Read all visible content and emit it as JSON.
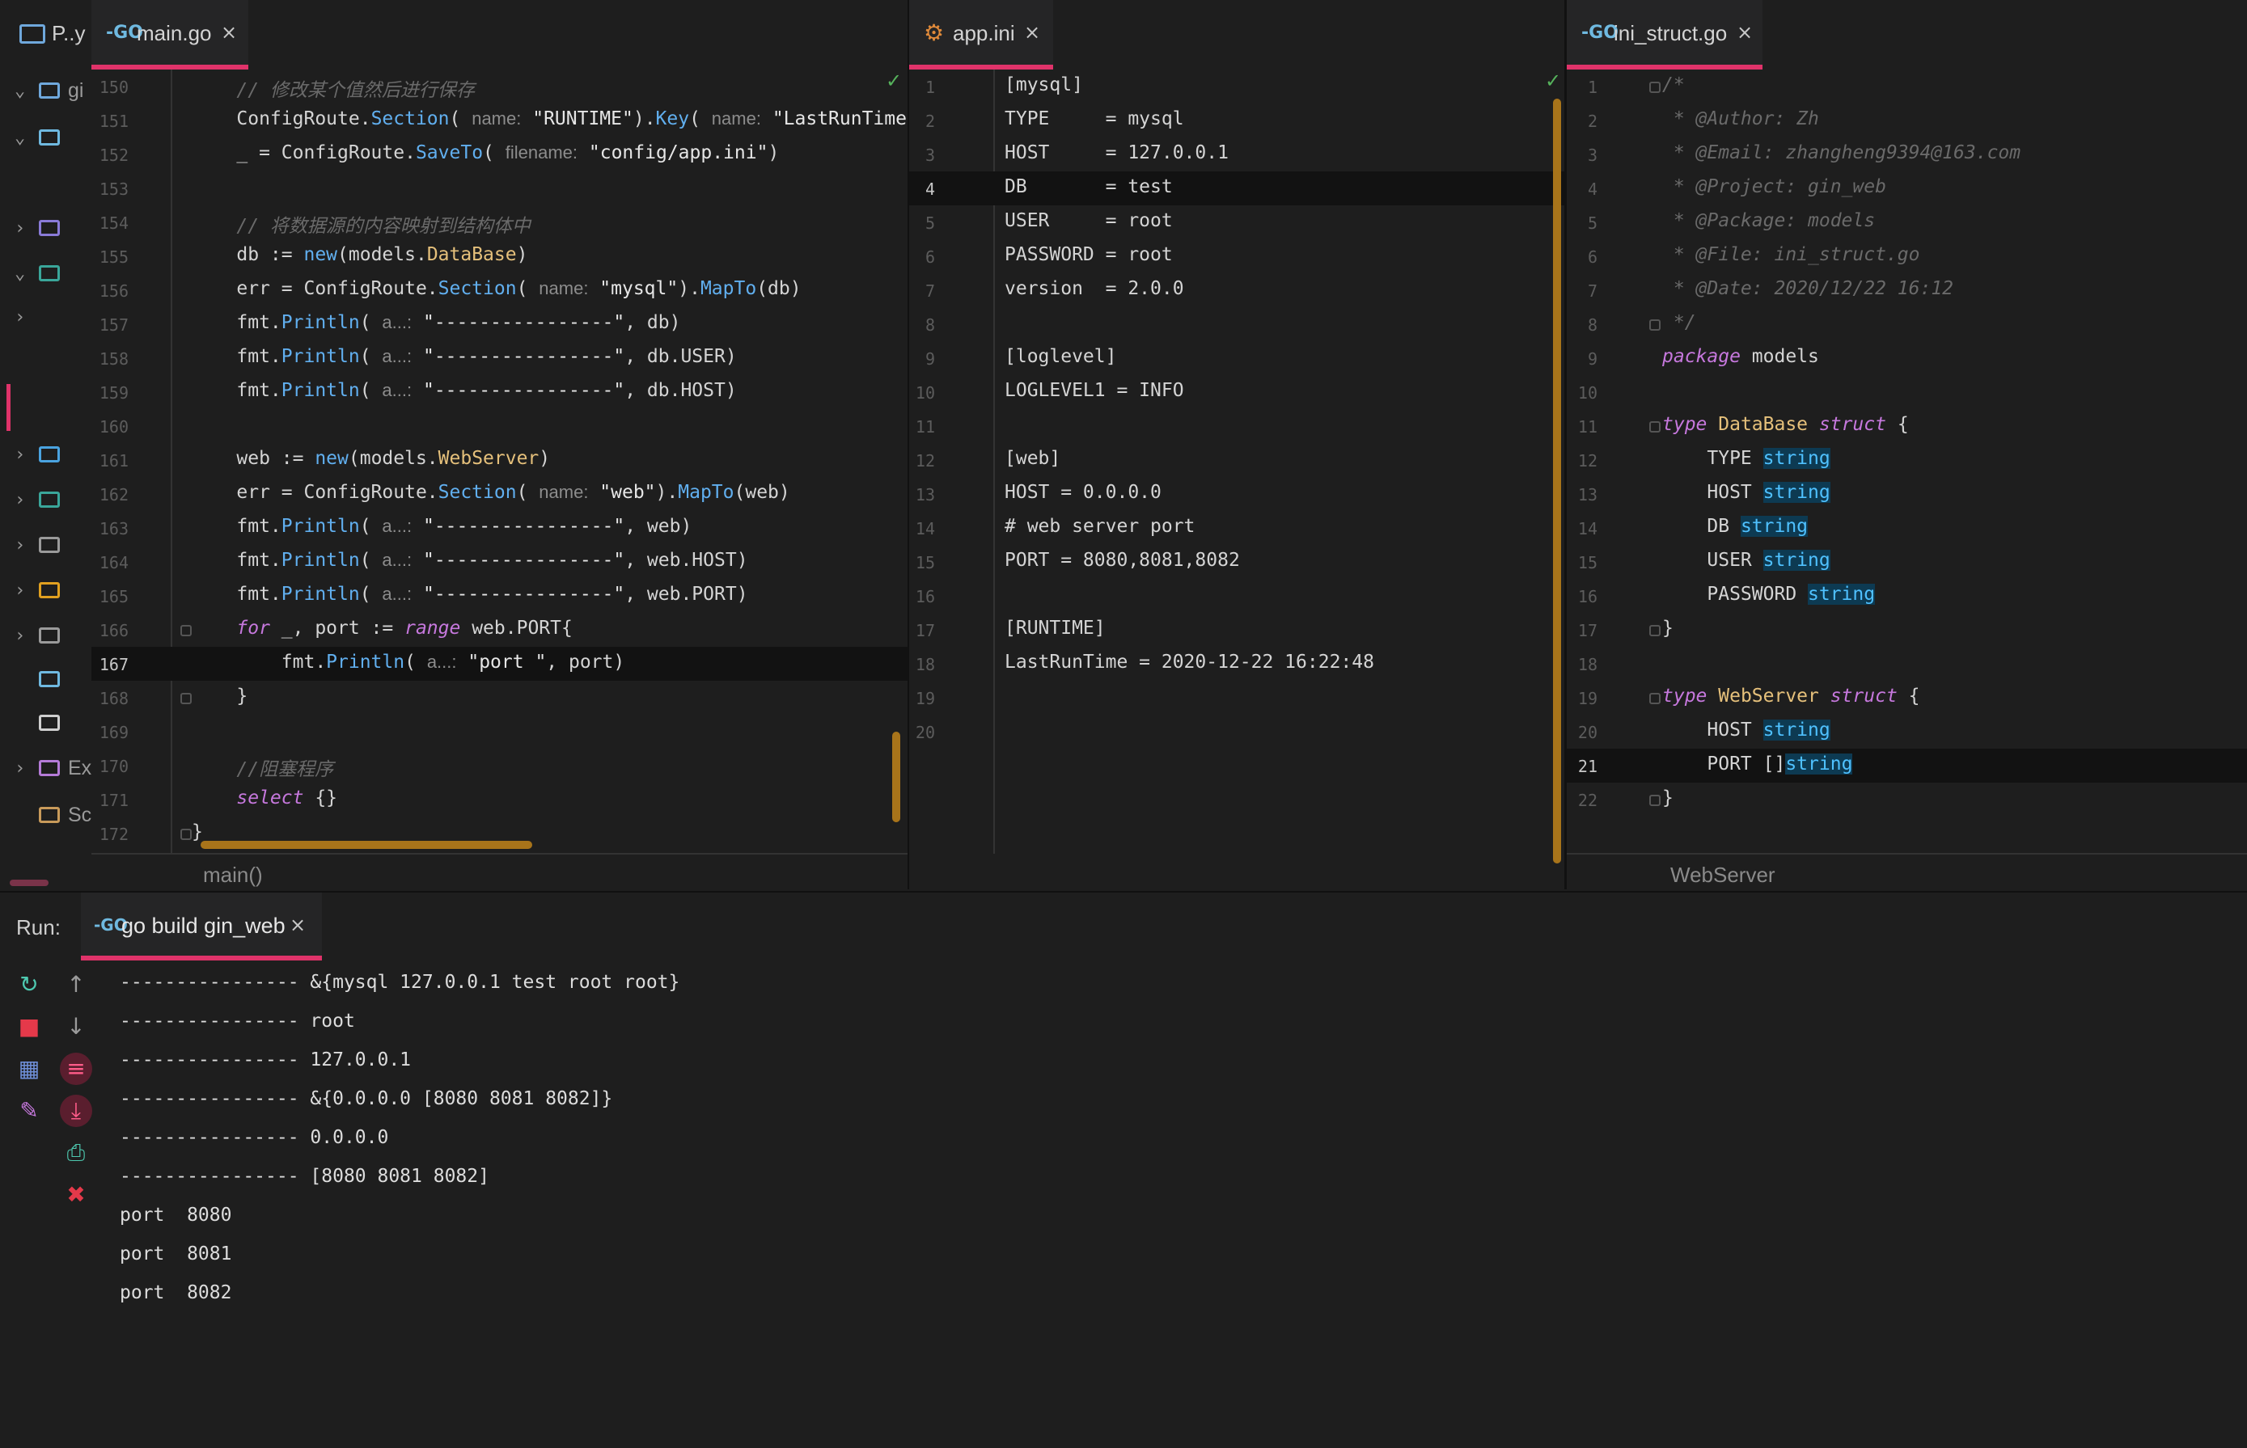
{
  "sidebar": {
    "project_label": "P..y",
    "items": [
      {
        "chev": "⌄",
        "text": "gi",
        "color": "#6fa8dc"
      },
      {
        "chev": "⌄",
        "text": "",
        "color": "#6fb9e0"
      },
      {
        "chev": "›",
        "text": "",
        "color": "#8a7bd8"
      },
      {
        "chev": "⌄",
        "text": "",
        "color": "#3aa69a"
      },
      {
        "chev": "›",
        "text": "",
        "color": ""
      },
      {
        "chev": "›",
        "text": "",
        "color": "#4aa3e0"
      },
      {
        "chev": "›",
        "text": "",
        "color": "#3aa69a"
      },
      {
        "chev": "›",
        "text": "",
        "color": "#9a9a9a"
      },
      {
        "chev": "›",
        "text": "",
        "color": "#e0a020"
      },
      {
        "chev": "›",
        "text": "",
        "color": "#9a9a9a"
      },
      {
        "chev": "",
        "text": "",
        "color": "#6fb9e0"
      },
      {
        "chev": "",
        "text": "",
        "color": "#cfcfcf"
      },
      {
        "chev": "›",
        "text": "Ex",
        "color": "#b57bd8"
      },
      {
        "chev": "",
        "text": "Sc",
        "color": "#c89a5a"
      }
    ]
  },
  "main_pane": {
    "tab_icon": "-GO",
    "tab_label": "main.go",
    "breadcrumb": "main()",
    "lines": [
      {
        "n": "150",
        "html": "    <span class=\"cm\">// 修改某个值然后进行保存</span>"
      },
      {
        "n": "151",
        "html": "    ConfigRoute.<span class=\"fn\">Section</span>( <span class=\"hint\">name:</span> <span class=\"str\">\"RUNTIME\"</span>).<span class=\"fn\">Key</span>( <span class=\"hint\">name:</span> <span class=\"str\">\"LastRunTime\"</span>)"
      },
      {
        "n": "152",
        "html": "    _ = ConfigRoute.<span class=\"fn\">SaveTo</span>( <span class=\"hint\">filename:</span> <span class=\"str\">\"config/app.ini\"</span>)"
      },
      {
        "n": "153",
        "html": ""
      },
      {
        "n": "154",
        "html": "    <span class=\"cm\">// 将数据源的内容映射到结构体中</span>"
      },
      {
        "n": "155",
        "html": "    db := <span class=\"fn\">new</span>(models.<span class=\"typ\">DataBase</span>)"
      },
      {
        "n": "156",
        "html": "    err = ConfigRoute.<span class=\"fn\">Section</span>( <span class=\"hint\">name:</span> <span class=\"str\">\"mysql\"</span>).<span class=\"fn\">MapTo</span>(db)"
      },
      {
        "n": "157",
        "html": "    fmt.<span class=\"fn\">Println</span>( <span class=\"hint\">a...:</span> <span class=\"str\">\"----------------\"</span>, db)"
      },
      {
        "n": "158",
        "html": "    fmt.<span class=\"fn\">Println</span>( <span class=\"hint\">a...:</span> <span class=\"str\">\"----------------\"</span>, db.USER)"
      },
      {
        "n": "159",
        "html": "    fmt.<span class=\"fn\">Println</span>( <span class=\"hint\">a...:</span> <span class=\"str\">\"----------------\"</span>, db.HOST)"
      },
      {
        "n": "160",
        "html": ""
      },
      {
        "n": "161",
        "html": "    web := <span class=\"fn\">new</span>(models.<span class=\"typ\">WebServer</span>)"
      },
      {
        "n": "162",
        "html": "    err = ConfigRoute.<span class=\"fn\">Section</span>( <span class=\"hint\">name:</span> <span class=\"str\">\"web\"</span>).<span class=\"fn\">MapTo</span>(web)"
      },
      {
        "n": "163",
        "html": "    fmt.<span class=\"fn\">Println</span>( <span class=\"hint\">a...:</span> <span class=\"str\">\"----------------\"</span>, web)"
      },
      {
        "n": "164",
        "html": "    fmt.<span class=\"fn\">Println</span>( <span class=\"hint\">a...:</span> <span class=\"str\">\"----------------\"</span>, web.HOST)"
      },
      {
        "n": "165",
        "html": "    fmt.<span class=\"fn\">Println</span>( <span class=\"hint\">a...:</span> <span class=\"str\">\"----------------\"</span>, web.PORT)"
      },
      {
        "n": "166",
        "html": "    <span class=\"kw\">for</span> _, port := <span class=\"kw\">range</span> web.PORT{"
      },
      {
        "n": "167",
        "html": "        fmt.<span class=\"fn\">Println</span>( <span class=\"hint\">a...:</span> <span class=\"str\">\"port \"</span>, port)"
      },
      {
        "n": "168",
        "html": "    }"
      },
      {
        "n": "169",
        "html": ""
      },
      {
        "n": "170",
        "html": "    <span class=\"cm\">//阻塞程序</span>"
      },
      {
        "n": "171",
        "html": "    <span class=\"kw\">select</span> {}"
      },
      {
        "n": "172",
        "html": "}"
      }
    ],
    "current_line": "167"
  },
  "ini_pane": {
    "tab_icon": "⚙",
    "tab_label": "app.ini",
    "lines": [
      {
        "n": "1",
        "text": "[mysql]"
      },
      {
        "n": "2",
        "text": "TYPE     = mysql"
      },
      {
        "n": "3",
        "text": "HOST     = 127.0.0.1"
      },
      {
        "n": "4",
        "text": "DB       = test"
      },
      {
        "n": "5",
        "text": "USER     = root"
      },
      {
        "n": "6",
        "text": "PASSWORD = root"
      },
      {
        "n": "7",
        "text": "version  = 2.0.0"
      },
      {
        "n": "8",
        "text": ""
      },
      {
        "n": "9",
        "text": "[loglevel]"
      },
      {
        "n": "10",
        "text": "LOGLEVEL1 = INFO"
      },
      {
        "n": "11",
        "text": ""
      },
      {
        "n": "12",
        "text": "[web]"
      },
      {
        "n": "13",
        "text": "HOST = 0.0.0.0"
      },
      {
        "n": "14",
        "text": "# web server port"
      },
      {
        "n": "15",
        "text": "PORT = 8080,8081,8082"
      },
      {
        "n": "16",
        "text": ""
      },
      {
        "n": "17",
        "text": "[RUNTIME]"
      },
      {
        "n": "18",
        "text": "LastRunTime = 2020-12-22 16:22:48"
      },
      {
        "n": "19",
        "text": ""
      },
      {
        "n": "20",
        "text": ""
      }
    ],
    "current_line": "4"
  },
  "struct_pane": {
    "tab_icon": "-GO",
    "tab_label": "ini_struct.go",
    "breadcrumb": "WebServer",
    "lines": [
      {
        "n": "1",
        "html": "<span class=\"cm\">/*</span>"
      },
      {
        "n": "2",
        "html": "<span class=\"cm\"> * @Author: Zh</span>"
      },
      {
        "n": "3",
        "html": "<span class=\"cm\"> * @Email: zhangheng9394@163.com</span>"
      },
      {
        "n": "4",
        "html": "<span class=\"cm\"> * @Project: gin_web</span>"
      },
      {
        "n": "5",
        "html": "<span class=\"cm\"> * @Package: models</span>"
      },
      {
        "n": "6",
        "html": "<span class=\"cm\"> * @File: ini_struct.go</span>"
      },
      {
        "n": "7",
        "html": "<span class=\"cm\"> * @Date: 2020/12/22 16:12</span>"
      },
      {
        "n": "8",
        "html": "<span class=\"cm\"> */</span>"
      },
      {
        "n": "9",
        "html": "<span class=\"pkgkw\">package</span> models"
      },
      {
        "n": "10",
        "html": ""
      },
      {
        "n": "11",
        "html": "<span class=\"kw\">type</span> <span class=\"typ\">DataBase</span> <span class=\"kw\">struct</span> {"
      },
      {
        "n": "12",
        "html": "    TYPE <span class=\"typehl\">string</span>"
      },
      {
        "n": "13",
        "html": "    HOST <span class=\"typehl\">string</span>"
      },
      {
        "n": "14",
        "html": "    DB <span class=\"typehl\">string</span>"
      },
      {
        "n": "15",
        "html": "    USER <span class=\"typehl\">string</span>"
      },
      {
        "n": "16",
        "html": "    PASSWORD <span class=\"typehl\">string</span>"
      },
      {
        "n": "17",
        "html": "}"
      },
      {
        "n": "18",
        "html": ""
      },
      {
        "n": "19",
        "html": "<span class=\"kw\">type</span> <span class=\"typ\">WebServer</span> <span class=\"kw\">struct</span> {"
      },
      {
        "n": "20",
        "html": "    HOST <span class=\"typehl\">string</span>"
      },
      {
        "n": "21",
        "html": "    PORT []<span class=\"typehl\">string</span>"
      },
      {
        "n": "22",
        "html": "}"
      }
    ],
    "current_line": "21"
  },
  "run_panel": {
    "label": "Run:",
    "tab_icon": "-GO",
    "tab_label": "go build gin_web",
    "output": [
      "---------------- &{mysql 127.0.0.1 test root root}",
      "---------------- root",
      "---------------- 127.0.0.1",
      "---------------- &{0.0.0.0 [8080 8081 8082]}",
      "---------------- 0.0.0.0",
      "---------------- [8080 8081 8082]",
      "port  8080",
      "port  8081",
      "port  8082"
    ],
    "tools": [
      {
        "name": "rerun-icon",
        "glyph": "↻",
        "color": "#4ec9b0"
      },
      {
        "name": "up-arrow-icon",
        "glyph": "↑",
        "color": "#9a9a9a"
      },
      {
        "name": "stop-icon",
        "glyph": "■",
        "color": "#e5394a"
      },
      {
        "name": "down-arrow-icon",
        "glyph": "↓",
        "color": "#9a9a9a"
      },
      {
        "name": "layout-icon",
        "glyph": "▦",
        "color": "#6f8fd8"
      },
      {
        "name": "soft-wrap-icon",
        "glyph": "≡",
        "color": "#e0336a"
      },
      {
        "name": "pin-icon",
        "glyph": "✎",
        "color": "#c678dd"
      },
      {
        "name": "scroll-to-end-icon",
        "glyph": "⤓",
        "color": "#e0336a"
      },
      {
        "name": "print-icon",
        "glyph": "⎙",
        "color": "#4ec9b0"
      },
      {
        "name": "trash-icon",
        "glyph": "✖",
        "color": "#e5394a"
      }
    ]
  },
  "colors": {
    "accent": "#e0336a",
    "background": "#1e1e1e",
    "scrollbar": "#a8741a",
    "check": "#56b35c"
  }
}
